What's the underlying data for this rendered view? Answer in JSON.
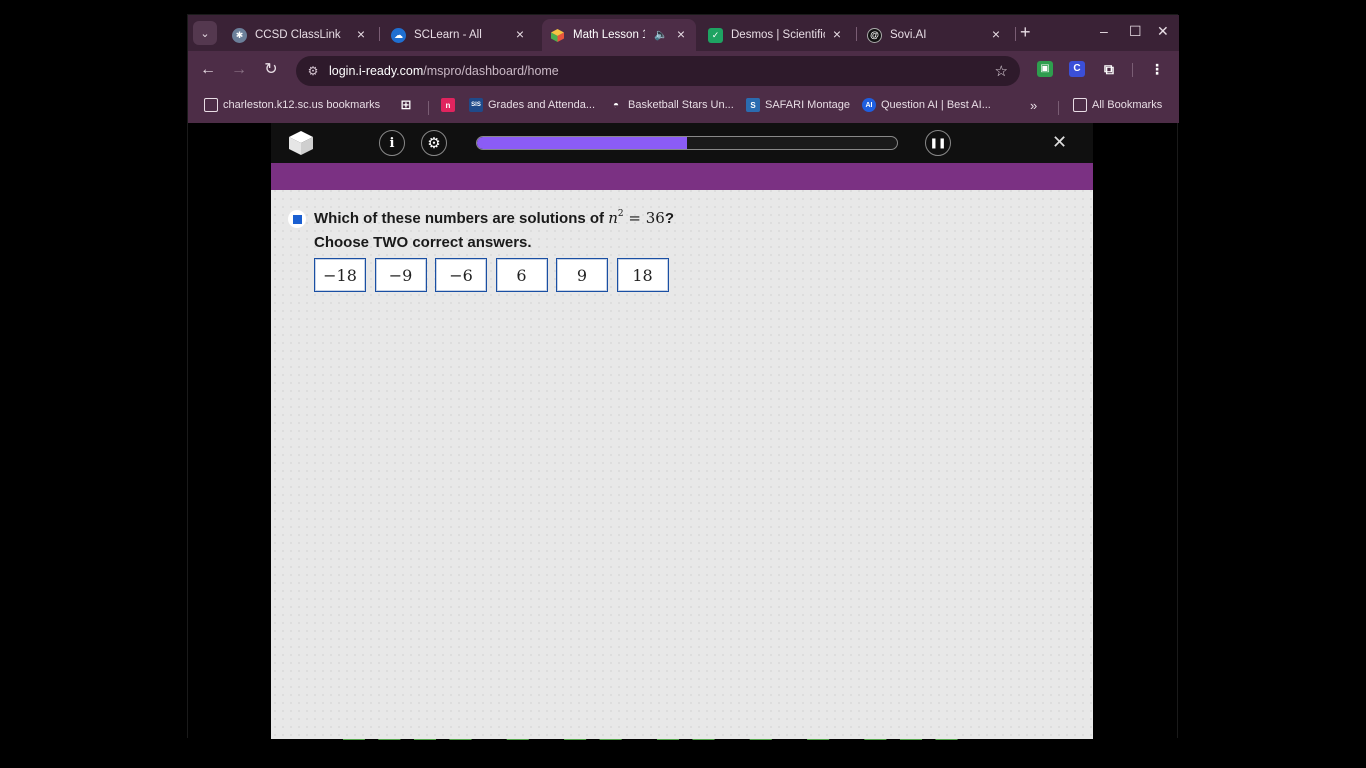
{
  "browser": {
    "tabs": [
      {
        "title": "CCSD ClassLink",
        "icon": "gear-globe-icon",
        "color": "#6b7f9a",
        "active": false
      },
      {
        "title": "SCLearn - All",
        "icon": "cloud-icon",
        "color": "#1f6fd1",
        "active": false
      },
      {
        "title": "Math Lesson 1...",
        "icon": "cube-icon",
        "color": "#f0a030",
        "active": true
      },
      {
        "title": "Desmos | Scientific",
        "icon": "check-icon",
        "color": "#1ea362",
        "active": false
      },
      {
        "title": "Sovi.AI",
        "icon": "spiral-icon",
        "color": "#111111",
        "active": false
      }
    ],
    "url_host": "login.i-ready.com",
    "url_path": "/mspro/dashboard/home",
    "bookmarks": [
      {
        "label": "charleston.k12.sc.us bookmarks",
        "icon": "managed-folder-icon"
      },
      {
        "label": "",
        "icon": "apps-grid-icon"
      },
      {
        "label": "",
        "icon": "n-logo-icon",
        "text": "n",
        "color": "#e0245e"
      },
      {
        "label": "Grades and Attenda...",
        "icon": "sis-icon",
        "text": "SIS",
        "color": "#1f4a8a"
      },
      {
        "label": "Basketball Stars Un...",
        "icon": "sunglasses-icon"
      },
      {
        "label": "SAFARI Montage",
        "icon": "safari-montage-icon",
        "text": "S",
        "color": "#2b6cb0"
      },
      {
        "label": "Question AI | Best AI...",
        "icon": "question-ai-icon",
        "text": "AI",
        "color": "#1f5fe0"
      },
      {
        "label": "All Bookmarks",
        "icon": "folder-icon"
      }
    ],
    "extensions": [
      {
        "icon": "screenshot-extension-icon",
        "color": "#2e9e4e"
      },
      {
        "icon": "c-extension-icon",
        "color": "#3b4fd8",
        "text": "C"
      }
    ]
  },
  "lesson": {
    "progress": 0.5,
    "question_prefix": "Which of these numbers are solutions of ",
    "equation_var": "n",
    "equation_exp": "2",
    "equation_rest": " = 36",
    "question_suffix": "?",
    "instructions": "Choose TWO correct answers.",
    "choices": [
      "−18",
      "−9",
      "−6",
      "6",
      "9",
      "18"
    ],
    "accent": "#7b3183",
    "progress_color": "#8b5cf6"
  }
}
